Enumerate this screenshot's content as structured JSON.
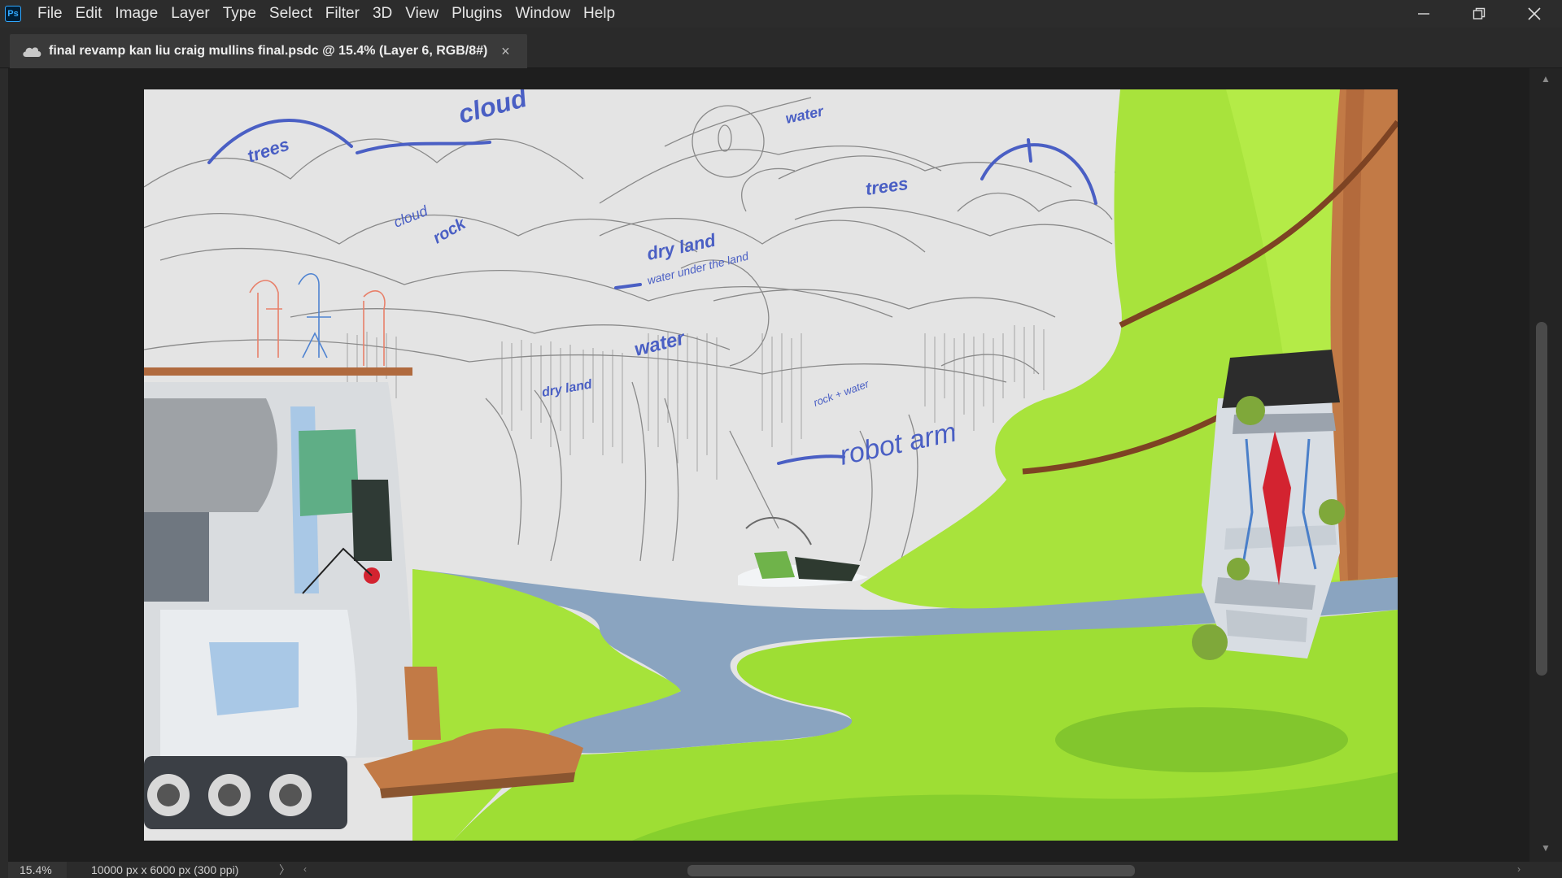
{
  "app": {
    "logo_text": "Ps",
    "menu": [
      "File",
      "Edit",
      "Image",
      "Layer",
      "Type",
      "Select",
      "Filter",
      "3D",
      "View",
      "Plugins",
      "Window",
      "Help"
    ]
  },
  "window_controls": {
    "icons": [
      "minimize-icon",
      "restore-icon",
      "close-icon"
    ]
  },
  "document_tab": {
    "title": "final revamp kan liu craig mullins final.psdc @ 15.4% (Layer 6, RGB/8#)",
    "close_glyph": "×",
    "icon": "cloud-icon"
  },
  "canvas": {
    "annotations": [
      "cloud",
      "trees",
      "cloud",
      "rock",
      "dry land",
      "water under the land",
      "water",
      "dry land",
      "trees",
      "rock + water",
      "robot arm",
      "water"
    ]
  },
  "status": {
    "zoom": "15.4%",
    "doc_info": "10000 px x 6000 px (300 ppi)",
    "chevron": "〉"
  },
  "colors": {
    "accent": "#31a8ff",
    "grass": "#a6e33a",
    "annotation_blue": "#4a5fc4",
    "water": "#8aa4c0",
    "tree_trunk": "#c27a46"
  }
}
